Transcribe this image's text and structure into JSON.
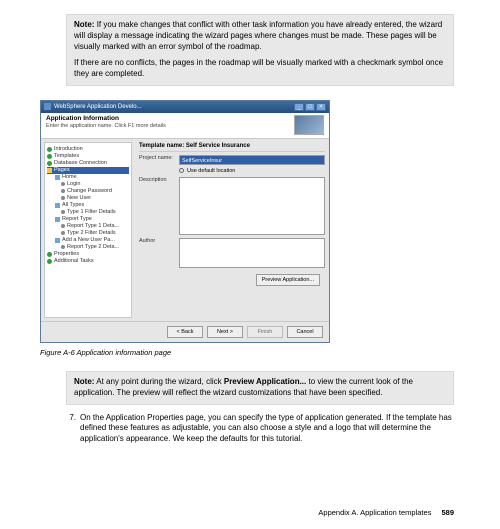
{
  "note1": {
    "lead": "Note:",
    "p1": "If you make changes that conflict with other task information you have already entered, the wizard will display a message indicating the wizard pages where changes must be made. These pages will be visually marked with an error symbol of the roadmap.",
    "p2": "If there are no conflicts, the pages in the roadmap will be visually marked with a checkmark symbol once they are completed."
  },
  "window": {
    "title": "WebSphere Application Develo...",
    "header_title": "Application Information",
    "header_sub": "Enter the application name. Click F1 more details",
    "section_title": "Template name: Self Service Insurance",
    "labels": {
      "project": "Project name:",
      "project_val": "SelfServiceInsur",
      "default_lbl": "Use default location",
      "desc": "Description",
      "author": "Author"
    },
    "tree": [
      {
        "icon": "check",
        "ind": 0,
        "label": "Introduction"
      },
      {
        "icon": "check",
        "ind": 0,
        "label": "Templates"
      },
      {
        "icon": "check",
        "ind": 0,
        "label": "Database Connection"
      },
      {
        "icon": "sel",
        "ind": 0,
        "label": "Pages",
        "sel": true
      },
      {
        "icon": "box",
        "ind": 8,
        "label": "Home"
      },
      {
        "icon": "dot",
        "ind": 14,
        "label": "Login"
      },
      {
        "icon": "dot",
        "ind": 14,
        "label": "Change Password"
      },
      {
        "icon": "dot",
        "ind": 14,
        "label": "New User"
      },
      {
        "icon": "box",
        "ind": 8,
        "label": "All Types"
      },
      {
        "icon": "dot",
        "ind": 14,
        "label": "Type 1 Filter Details"
      },
      {
        "icon": "box",
        "ind": 8,
        "label": "Report Type"
      },
      {
        "icon": "dot",
        "ind": 14,
        "label": "Report Type 1 Deta..."
      },
      {
        "icon": "dot",
        "ind": 14,
        "label": "Type 2 Filter Details"
      },
      {
        "icon": "box",
        "ind": 8,
        "label": "Add a New User Pa..."
      },
      {
        "icon": "dot",
        "ind": 14,
        "label": "Report Type 2 Deta..."
      },
      {
        "icon": "check",
        "ind": 0,
        "label": "Properties"
      },
      {
        "icon": "check",
        "ind": 0,
        "label": "Additional Tasks"
      }
    ],
    "buttons": {
      "preview": "Preview Application...",
      "back": "< Back",
      "next": "Next >",
      "finish": "Finish",
      "cancel": "Cancel"
    }
  },
  "figure_caption": "Figure A-6   Application information page",
  "note2": {
    "lead": "Note:",
    "body_a": "At any point during the wizard, click ",
    "body_bold": "Preview Application...",
    "body_b": " to view the current look of the application. The preview will reflect the wizard customizations that have been specified."
  },
  "step7": {
    "num": "7.",
    "text": "On the Application Properties page, you can specify the type of application generated. If the template has defined these features as adjustable, you can also choose a style and a logo that will determine the application's appearance. We keep the defaults for this tutorial."
  },
  "footer": {
    "section": "Appendix A. Application templates",
    "page": "589"
  }
}
